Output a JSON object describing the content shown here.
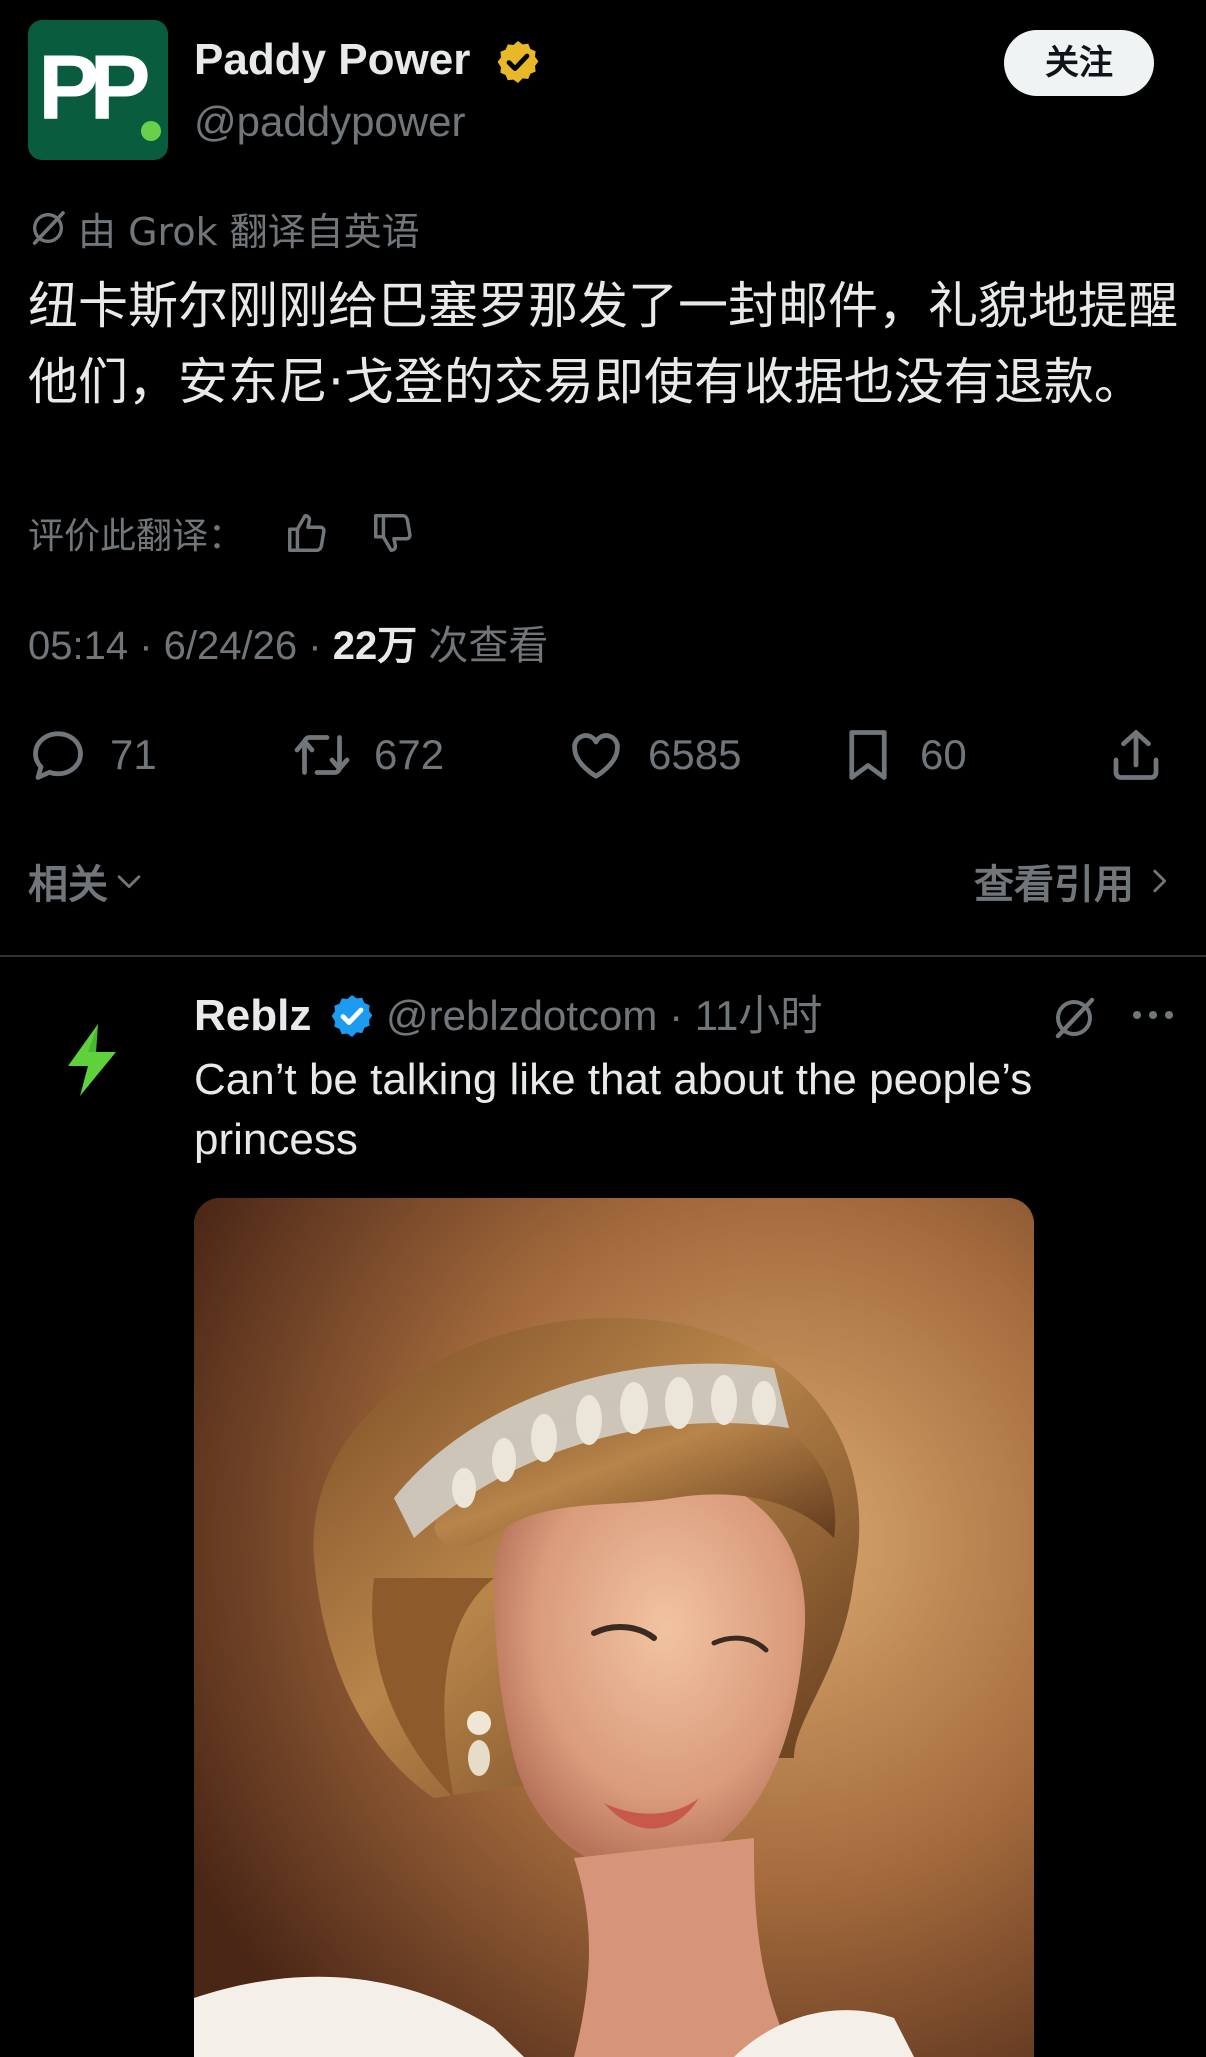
{
  "tweet": {
    "author": {
      "name": "Paddy Power",
      "handle": "@paddypower",
      "avatar_text": "PP",
      "verified_badge": "gold-verified-badge-icon"
    },
    "follow_label": "关注",
    "translation_label": "由 Grok 翻译自英语",
    "text": "纽卡斯尔刚刚给巴塞罗那发了一封邮件，礼貌地提醒他们，安东尼·戈登的交易即使有收据也没有退款。",
    "rate_label": "评价此翻译：",
    "time": "05:14",
    "date": "6/24/26",
    "views_count": "22万",
    "views_label": "次查看",
    "actions": {
      "replies": "71",
      "retweets": "672",
      "likes": "6585",
      "bookmarks": "60"
    },
    "related_label": "相关",
    "quotes_label": "查看引用"
  },
  "reply": {
    "author": "Reblz",
    "handle": "@reblzdotcom",
    "separator": "·",
    "time": "11小时",
    "text": "Can’t be talking like that about the people’s princess",
    "verified_badge": "blue-verified-badge-icon"
  },
  "colors": {
    "background": "#000000",
    "text": "#e7e9ea",
    "muted": "#71767b",
    "avatar_green": "#0a5c3e",
    "gold": "#e8b829",
    "blue": "#1d9bf0",
    "lightning": "#5fd13b"
  }
}
